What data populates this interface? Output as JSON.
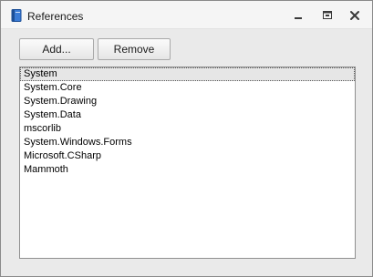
{
  "window": {
    "title": "References",
    "icon": "book-icon",
    "controls": {
      "minimize_icon": "minimize-icon",
      "maximize_icon": "maximize-icon",
      "close_icon": "close-icon"
    }
  },
  "toolbar": {
    "add_label": "Add...",
    "remove_label": "Remove"
  },
  "references": {
    "items": [
      "System",
      "System.Core",
      "System.Drawing",
      "System.Data",
      "mscorlib",
      "System.Windows.Forms",
      "Microsoft.CSharp",
      "Mammoth"
    ],
    "selected": "System"
  },
  "colors": {
    "window_background": "#eaeaea",
    "list_background": "#ffffff",
    "selection_background": "#e6e6e6"
  }
}
